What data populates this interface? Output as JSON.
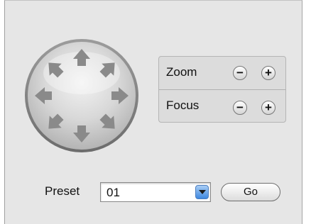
{
  "ptz": {
    "arrows": [
      "up",
      "up-right",
      "right",
      "down-right",
      "down",
      "down-left",
      "left",
      "up-left"
    ]
  },
  "zoom": {
    "label": "Zoom",
    "minus": "−",
    "plus": "+"
  },
  "focus": {
    "label": "Focus",
    "minus": "−",
    "plus": "+"
  },
  "preset": {
    "label": "Preset",
    "value": "01",
    "go_label": "Go"
  },
  "colors": {
    "panel": "#e6e6e6",
    "arrow": "#8a8a8a",
    "dropdown_accent": "#3e88e0"
  }
}
